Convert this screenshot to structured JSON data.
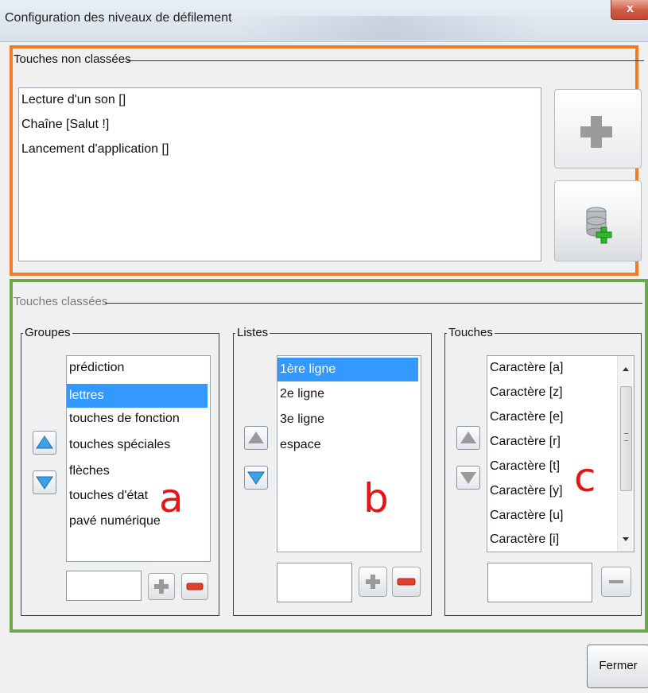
{
  "window": {
    "title": "Configuration des niveaux de défilement",
    "close_label": "x"
  },
  "unsorted": {
    "legend": "Touches non classées",
    "items": [
      "Lecture d'un son []",
      "Chaîne [Salut !]",
      "Lancement d'application []"
    ],
    "border_color": "#f07c2a"
  },
  "sorted": {
    "legend": "Touches classées",
    "border_color": "#6aa84f",
    "groups": {
      "legend": "Groupes",
      "items": [
        "prédiction",
        "lettres",
        "touches de fonction",
        "touches spéciales",
        "flèches",
        "touches d'état",
        "pavé numérique"
      ],
      "selected_index": 1,
      "annotation": "a"
    },
    "lists": {
      "legend": "Listes",
      "items": [
        "1ère ligne",
        "2e ligne",
        "3e ligne",
        "espace"
      ],
      "selected_index": 0,
      "annotation": "b"
    },
    "keys": {
      "legend": "Touches",
      "items": [
        "Caractère [a]",
        "Caractère [z]",
        "Caractère [e]",
        "Caractère [r]",
        "Caractère [t]",
        "Caractère [y]",
        "Caractère [u]",
        "Caractère [i]"
      ],
      "annotation": "c"
    }
  },
  "buttons": {
    "close": "Fermer"
  },
  "colors": {
    "selection": "#3399ff",
    "plus_green": "#2fb62f",
    "minus_red": "#e0402a",
    "annotation_red": "#e81414"
  }
}
